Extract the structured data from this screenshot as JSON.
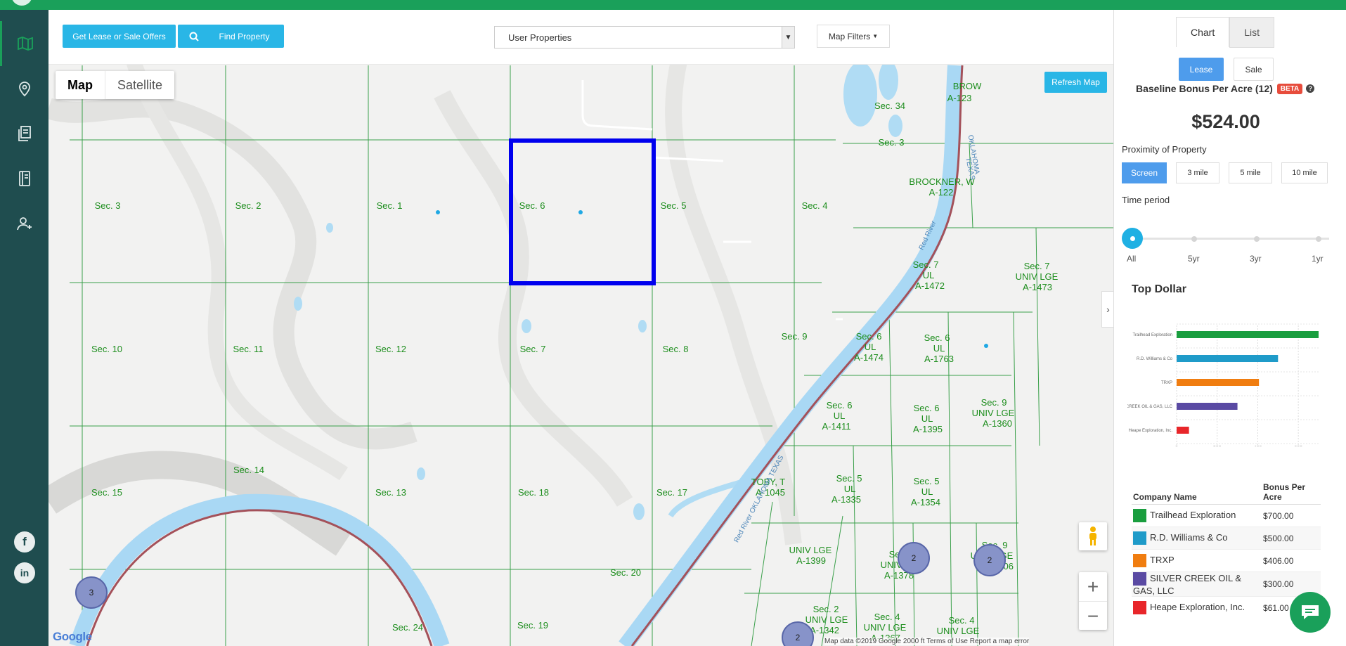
{
  "colors": {
    "brand_green": "#1aa05a",
    "nav_bg": "#1f4d4f",
    "accent_blue": "#29b6e6",
    "selection_blue": "#0000ee"
  },
  "sidebar": {
    "items": [
      {
        "icon": "map-icon",
        "active": true
      },
      {
        "icon": "location-pin-icon",
        "active": false
      },
      {
        "icon": "documents-icon",
        "active": false
      },
      {
        "icon": "notebook-icon",
        "active": false
      },
      {
        "icon": "add-user-icon",
        "active": false
      }
    ],
    "social": {
      "facebook": "f",
      "linkedin": "in"
    }
  },
  "toolbar": {
    "offers_label": "Get Lease or Sale Offers",
    "find_label": "Find Property",
    "layer_select_value": "User Properties",
    "map_filters_label": "Map Filters"
  },
  "map": {
    "type_map": "Map",
    "type_satellite": "Satellite",
    "refresh_label": "Refresh Map",
    "google_logo": "Google",
    "attribution": "Map data ©2019 Google   2000 ft   Terms of Use   Report a map error",
    "sections": [
      {
        "text": "Sec. 3"
      },
      {
        "text": "Sec. 2"
      },
      {
        "text": "Sec. 1"
      },
      {
        "text": "Sec. 6"
      },
      {
        "text": "Sec. 5"
      },
      {
        "text": "Sec. 4"
      },
      {
        "text": "Sec. 10"
      },
      {
        "text": "Sec. 11"
      },
      {
        "text": "Sec. 12"
      },
      {
        "text": "Sec. 7"
      },
      {
        "text": "Sec. 8"
      },
      {
        "text": "Sec. 9"
      },
      {
        "text": "Sec. 14"
      },
      {
        "text": "Sec. 15"
      },
      {
        "text": "Sec. 13"
      },
      {
        "text": "Sec. 18"
      },
      {
        "text": "Sec. 17"
      },
      {
        "text": "Sec. 20"
      },
      {
        "text": "Sec. 24"
      },
      {
        "text": "Sec. 19"
      },
      {
        "text": "Sec. 34"
      },
      {
        "text": "Sec. 3"
      },
      {
        "text": "BROCKNER, W"
      },
      {
        "text": "A-122"
      },
      {
        "text": "BROW"
      },
      {
        "text": "A-123"
      },
      {
        "text": "Sec. 7"
      },
      {
        "text": "UL"
      },
      {
        "text": "A-1472"
      },
      {
        "text": "Sec. 7"
      },
      {
        "text": "UNIV LGE"
      },
      {
        "text": "A-1473"
      },
      {
        "text": "Sec. 6"
      },
      {
        "text": "UL"
      },
      {
        "text": "A-1474"
      },
      {
        "text": "Sec. 6"
      },
      {
        "text": "UL"
      },
      {
        "text": "A-1763"
      },
      {
        "text": "Sec. 6"
      },
      {
        "text": "UL"
      },
      {
        "text": "A-1411"
      },
      {
        "text": "Sec. 6"
      },
      {
        "text": "UL"
      },
      {
        "text": "A-1395"
      },
      {
        "text": "Sec. 9"
      },
      {
        "text": "UNIV LGE"
      },
      {
        "text": "A-1360"
      },
      {
        "text": "TOBY, T"
      },
      {
        "text": "A-1045"
      },
      {
        "text": "Sec. 5"
      },
      {
        "text": "UL"
      },
      {
        "text": "A-1335"
      },
      {
        "text": "Sec. 5"
      },
      {
        "text": "UL"
      },
      {
        "text": "A-1354"
      },
      {
        "text": "UNIV LGE"
      },
      {
        "text": "A-1399"
      },
      {
        "text": "Sec. 5"
      },
      {
        "text": "UNIV LGE"
      },
      {
        "text": "A-1378"
      },
      {
        "text": "Sec. 9"
      },
      {
        "text": "UNIV LGE"
      },
      {
        "text": "A-1406"
      },
      {
        "text": "Sec. 2"
      },
      {
        "text": "UNIV LGE"
      },
      {
        "text": "A-1342"
      },
      {
        "text": "Sec. 4"
      },
      {
        "text": "UNIV LGE"
      },
      {
        "text": "A-1367"
      },
      {
        "text": "Sec. 4"
      },
      {
        "text": "UNIV LGE"
      }
    ],
    "river_labels": [
      "Red River",
      "OKLAHOMA",
      "TEXAS",
      "Red River OKLAHOMA TEXAS"
    ],
    "clusters": [
      "3",
      "2",
      "2",
      "2"
    ]
  },
  "panel": {
    "tabs": [
      "Chart",
      "List"
    ],
    "mode": [
      "Lease",
      "Sale"
    ],
    "title": "Baseline Bonus Per Acre (12)",
    "beta": "BETA",
    "price": "$524.00",
    "proximity_label": "Proximity of Property",
    "proximity": [
      "Screen",
      "3 mile",
      "5 mile",
      "10 mile"
    ],
    "time_label": "Time period",
    "time": [
      "All",
      "5yr",
      "3yr",
      "1yr"
    ],
    "top_dollar_title": "Top Dollar",
    "table": {
      "headers": [
        "Company Name",
        "Bonus Per Acre"
      ],
      "rows": [
        {
          "company": "Trailhead Exploration",
          "value": "$700.00",
          "color": "#1a9e3f"
        },
        {
          "company": "R.D. Williams & Co",
          "value": "$500.00",
          "color": "#1f9bc9"
        },
        {
          "company": "TRXP",
          "value": "$406.00",
          "color": "#f07d10"
        },
        {
          "company": "SILVER CREEK OIL & GAS, LLC",
          "value": "$300.00",
          "color": "#5a4aa3"
        },
        {
          "company": "Heape Exploration, Inc.",
          "value": "$61.00",
          "color": "#e8262a"
        }
      ]
    }
  },
  "chart_data": {
    "type": "bar",
    "orientation": "horizontal",
    "title": "Top Dollar",
    "categories": [
      "Trailhead Exploration",
      "R.D. Williams & Co",
      "TRXP",
      "SILVER CREEK OIL & GAS, LLC",
      "Heape Exploration, Inc."
    ],
    "values": [
      700,
      500,
      406,
      300,
      61
    ],
    "colors": [
      "#1a9e3f",
      "#1f9bc9",
      "#f07d10",
      "#5a4aa3",
      "#e8262a"
    ],
    "xlim": [
      0,
      700
    ],
    "xticks": [
      "0",
      "200",
      "400",
      "600"
    ],
    "grid": true
  }
}
